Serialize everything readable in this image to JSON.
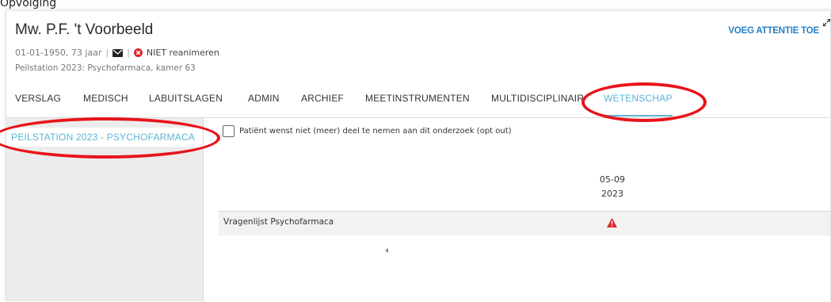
{
  "top_partial_text": "Opvolging",
  "header": {
    "patient_name": "Mw. P.F. 't Voorbeeld",
    "birth_age": "01-01-1950, 73 jaar",
    "separator": "|",
    "resuscitation": "NIET reanimeren",
    "location": "Peilstation 2023: Psychofarmaca, kamer 63",
    "attention_button": "VOEG ATTENTIE TOE"
  },
  "tabs": [
    {
      "label": "VERSLAG"
    },
    {
      "label": "MEDISCH"
    },
    {
      "label": "LABUITSLAGEN"
    },
    {
      "label": "ADMIN"
    },
    {
      "label": "ARCHIEF"
    },
    {
      "label": "MEETINSTRUMENTEN"
    },
    {
      "label": "MULTIDISCIPLINAIR"
    },
    {
      "label": "WETENSCHAP"
    }
  ],
  "sidebar": {
    "items": [
      {
        "label": "PEILSTATION 2023 - PSYCHOFARMACA"
      }
    ]
  },
  "study": {
    "optout_label": "Patiënt wenst niet (meer) deel te nemen aan dit onderzoek (opt out)",
    "optout_checked": false,
    "date_header": {
      "day_month": "05-09",
      "year": "2023"
    },
    "rows": [
      {
        "label": "Vragenlijst Psychofarmaca",
        "status": "warning-icon"
      }
    ]
  },
  "colors": {
    "accent": "#5ab4d6",
    "link": "#2a7fc1",
    "warning": "#d9262a",
    "annotation": "#e8141b"
  }
}
